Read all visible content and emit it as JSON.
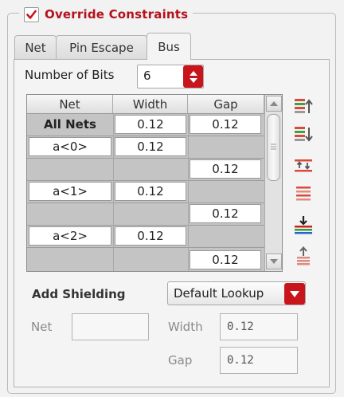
{
  "group": {
    "title": "Override Constraints",
    "checked": true
  },
  "tabs": [
    {
      "label": "Net",
      "active": false
    },
    {
      "label": "Pin Escape",
      "active": false
    },
    {
      "label": "Bus",
      "active": true
    }
  ],
  "number_of_bits": {
    "label": "Number of Bits",
    "value": "6"
  },
  "table": {
    "headers": {
      "net": "Net",
      "width": "Width",
      "gap": "Gap"
    },
    "rows": [
      {
        "net": "All Nets",
        "width": "0.12",
        "gap": "0.12"
      },
      {
        "net": "a<0>",
        "width": "0.12",
        "gap": ""
      },
      {
        "net": "",
        "width": "",
        "gap": "0.12"
      },
      {
        "net": "a<1>",
        "width": "0.12",
        "gap": ""
      },
      {
        "net": "",
        "width": "",
        "gap": "0.12"
      },
      {
        "net": "a<2>",
        "width": "0.12",
        "gap": ""
      },
      {
        "net": "",
        "width": "",
        "gap": "0.12"
      }
    ]
  },
  "side_icons": [
    "move-up-icon",
    "move-down-icon",
    "swap-icon",
    "clear-lines-icon",
    "import-icon",
    "upload-icon"
  ],
  "shielding": {
    "label": "Add Shielding",
    "combo_value": "Default Lookup",
    "net_label": "Net",
    "net_value": "",
    "width_label": "Width",
    "width_value": "0.12",
    "gap_label": "Gap",
    "gap_value": "0.12"
  },
  "colors": {
    "accent_red": "#c8141b",
    "title_red": "#b3121c"
  }
}
